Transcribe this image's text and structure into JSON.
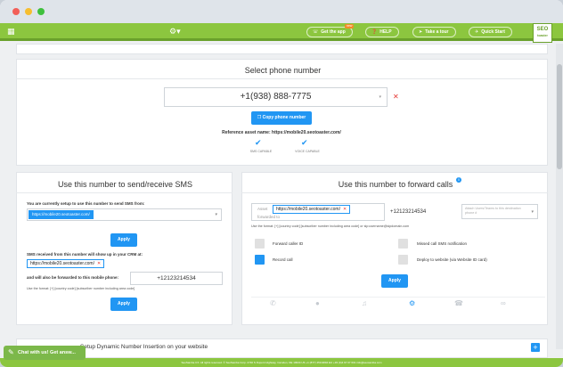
{
  "nav": {
    "get_app": "Get the app",
    "new_badge": "new",
    "help": "HELP",
    "tour": "Take a tour",
    "quick_start": "Quick Start",
    "logo_line1": "SEO",
    "logo_line2": "toaster"
  },
  "select_card": {
    "title": "Select phone number",
    "phone_number": "+1(938) 888-7775",
    "copy_button": "Copy phone number",
    "reference_label": "Reference asset name: https://mobile20.seotoaster.com/",
    "sms_cap": "SMS CAPABLE",
    "voice_cap": "VOICE CAPABLE"
  },
  "sms_card": {
    "title": "Use this number to send/receive SMS",
    "send_label": "You are currently setup to use this number to send SMS from:",
    "send_chip": "https://mobile20.seotoaster.com/",
    "apply1": "Apply",
    "received_label": "SMS received from this number will show up in your CRM at:",
    "received_chip": "https://mobile20.seotoaster.com/",
    "forward_label": "and will also be forwarded to this mobile phone:",
    "forward_phone": "+12123214534",
    "format_hint": "Use the format: [+] [country code] [subscriber number including area code]",
    "apply2": "Apply"
  },
  "fwd_card": {
    "title": "Use this number to forward calls",
    "asset_label": "Asset",
    "asset_chip": "https://mobile20.seotoaster.com/",
    "forwarded_to": "forwarded to",
    "forward_phone": "+12123214534",
    "attach_placeholder": "Attach Users/Teams to this destination phone #",
    "format_hint": "Use the format: [+] [country code] [subscriber number including area code] or sip:username@sipdomain.com",
    "forward_caller_id": "Forward caller ID",
    "missed_call_sms": "Missed call SMS notification",
    "record_call": "Record call",
    "deploy_website": "Deploy to website (via Website ID card)",
    "apply": "Apply"
  },
  "bottom": {
    "setup_dni": "Setup Dynamic Number Insertion on your website",
    "chat": "Chat with us! Get answ...",
    "footer": "SeoSamba CX. All rights reserved. © SeoSamba Corp. 2740 S Dupont Highway, Camden, DE 19934 US  +1 (877) 450-9894  EU +33 (0)4 67 07 601  info@seosamba.com"
  },
  "icons": {
    "grid": "grid-icon",
    "gear": "gear-icon",
    "chat": "chat-bubble-icon"
  }
}
